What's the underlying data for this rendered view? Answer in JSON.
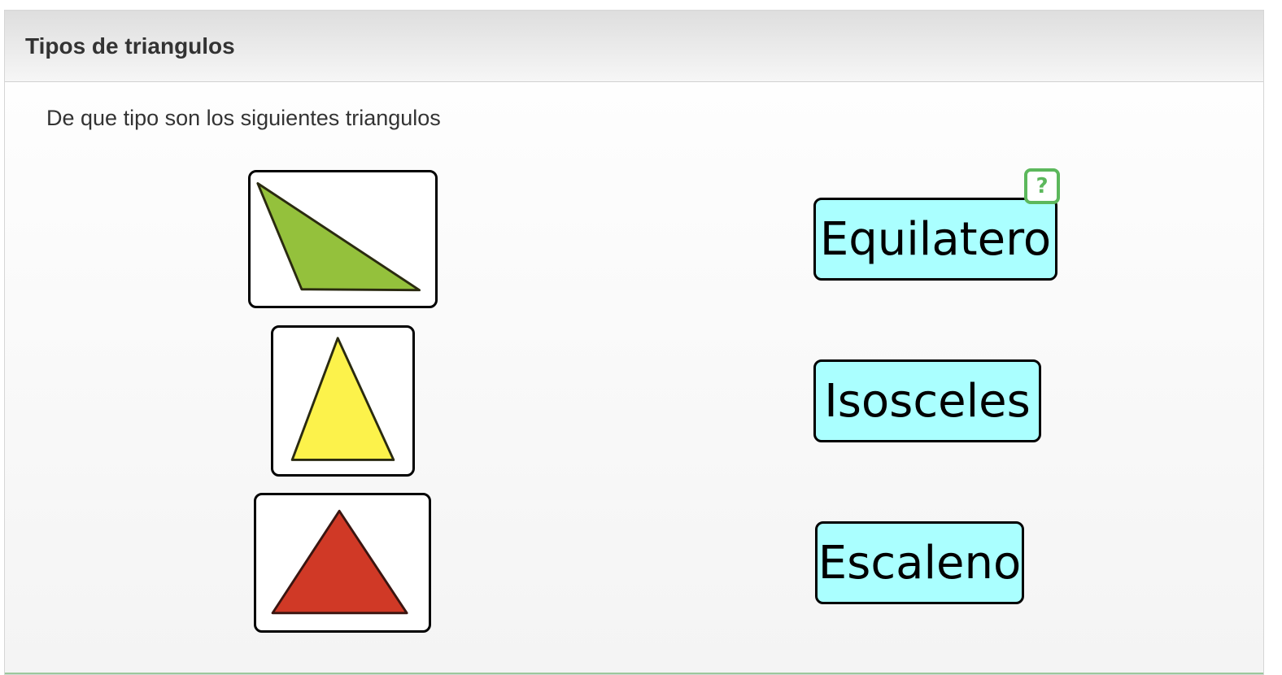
{
  "panel": {
    "title": "Tipos de triangulos",
    "instructions": "De que tipo son los siguientes triangulos"
  },
  "images": [
    {
      "name": "green-obtuse-triangle",
      "fill": "#94c13c"
    },
    {
      "name": "yellow-isosceles-triangle",
      "fill": "#fcf24b"
    },
    {
      "name": "red-triangle",
      "fill": "#d03926"
    }
  ],
  "labels": [
    {
      "text": "Equilatero",
      "bg": "#aaffff"
    },
    {
      "text": "Isosceles",
      "bg": "#aaffff"
    },
    {
      "text": "Escaleno",
      "bg": "#aaffff"
    }
  ],
  "help": {
    "label": "?",
    "color": "#5cb85c",
    "icon": "help-icon"
  }
}
